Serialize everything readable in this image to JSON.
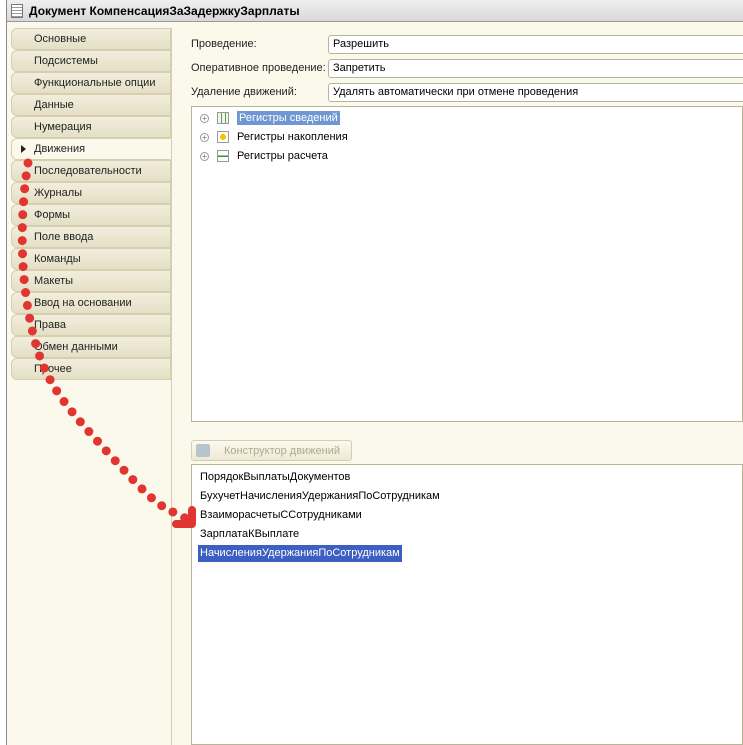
{
  "window": {
    "title": "Документ КомпенсацияЗаЗадержкуЗарплаты"
  },
  "tabs": [
    "Основные",
    "Подсистемы",
    "Функциональные опции",
    "Данные",
    "Нумерация",
    "Движения",
    "Последовательности",
    "Журналы",
    "Формы",
    "Поле ввода",
    "Команды",
    "Макеты",
    "Ввод на основании",
    "Права",
    "Обмен данными",
    "Прочее"
  ],
  "active_tab": "Движения",
  "fields": [
    {
      "label": "Проведение:",
      "value": "Разрешить"
    },
    {
      "label": "Оперативное проведение:",
      "value": "Запретить"
    },
    {
      "label": "Удаление движений:",
      "value": "Удалять автоматически при отмене проведения"
    }
  ],
  "tree": [
    "Регистры сведений",
    "Регистры накопления",
    "Регистры расчета"
  ],
  "constructor_button": "Конструктор движений",
  "registers": [
    "ПорядокВыплатыДокументов",
    "БухучетНачисленияУдержанияПоСотрудникам",
    "ВзаиморасчетыССотрудниками",
    "ЗарплатаКВыплате",
    "НачисленияУдержанияПоСотрудникам"
  ],
  "selected_register": "НачисленияУдержанияПоСотрудникам",
  "annotation_color": "#e03530"
}
